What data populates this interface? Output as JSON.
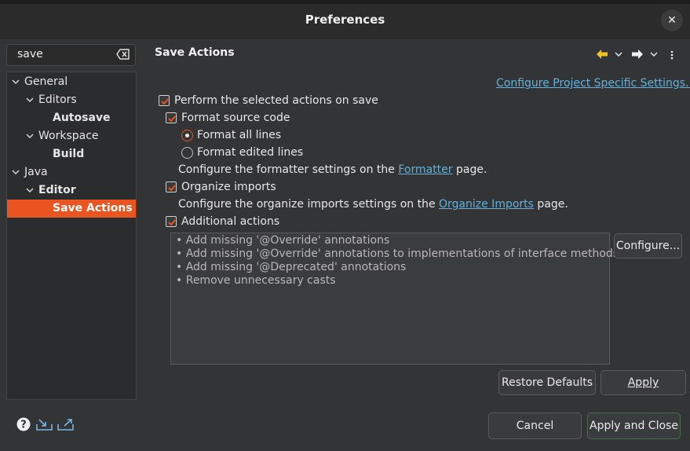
{
  "window": {
    "title": "Preferences",
    "close_glyph": "✕"
  },
  "search": {
    "value": "save"
  },
  "tree": {
    "items": [
      {
        "label": "General",
        "level": 0,
        "expanded": true,
        "bold": false,
        "selected": false
      },
      {
        "label": "Editors",
        "level": 1,
        "expanded": true,
        "bold": false,
        "selected": false
      },
      {
        "label": "Autosave",
        "level": 2,
        "expanded": null,
        "bold": true,
        "selected": false
      },
      {
        "label": "Workspace",
        "level": 1,
        "expanded": true,
        "bold": false,
        "selected": false
      },
      {
        "label": "Build",
        "level": 2,
        "expanded": null,
        "bold": true,
        "selected": false
      },
      {
        "label": "Java",
        "level": 0,
        "expanded": true,
        "bold": false,
        "selected": false
      },
      {
        "label": "Editor",
        "level": 1,
        "expanded": true,
        "bold": true,
        "selected": false
      },
      {
        "label": "Save Actions",
        "level": 2,
        "expanded": null,
        "bold": true,
        "selected": true
      }
    ]
  },
  "page": {
    "title": "Save Actions",
    "project_settings_link": "Configure Project Specific Settings...",
    "perform_actions": {
      "label": "Perform the selected actions on save",
      "checked": true
    },
    "format_source": {
      "label": "Format source code",
      "checked": true
    },
    "format_all": {
      "label": "Format all lines",
      "selected": true
    },
    "format_edited": {
      "label": "Format edited lines",
      "selected": false
    },
    "formatter_note": {
      "pre": "Configure the formatter settings on the ",
      "link": "Formatter",
      "post": " page."
    },
    "organize_imports": {
      "label": "Organize imports",
      "checked": true
    },
    "organize_note": {
      "pre": "Configure the organize imports settings on the ",
      "link": "Organize Imports",
      "post": " page."
    },
    "additional_actions": {
      "label": "Additional actions",
      "checked": true
    },
    "actions_list": [
      "Add missing '@Override' annotations",
      "Add missing '@Override' annotations to implementations of interface methods",
      "Add missing '@Deprecated' annotations",
      "Remove unnecessary casts"
    ],
    "configure_button": "Configure...",
    "restore_defaults": "Restore Defaults",
    "apply": "Apply"
  },
  "footer": {
    "cancel": "Cancel",
    "apply_close": "Apply and Close"
  },
  "colors": {
    "accent": "#e95420",
    "link": "#63b1dc",
    "background": "#323435"
  }
}
